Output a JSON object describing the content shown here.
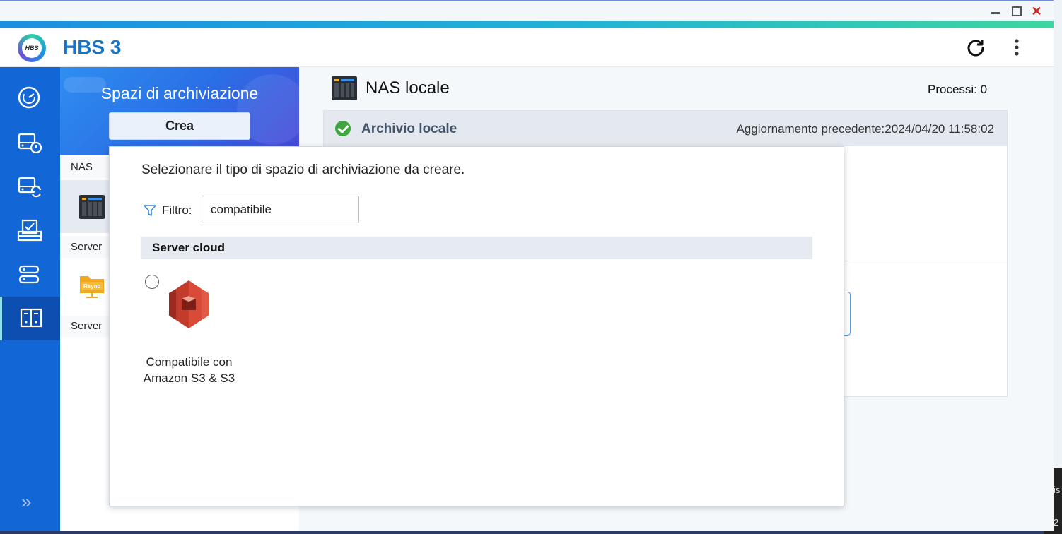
{
  "app": {
    "title": "HBS 3",
    "logo_text": "HBS"
  },
  "window_controls": {
    "minimize": "minimize-icon",
    "maximize": "maximize-icon",
    "close": "close-icon"
  },
  "header": {
    "refresh_icon": "refresh-icon",
    "more_icon": "more-vertical-icon"
  },
  "sidebar": {
    "items": [
      {
        "icon": "dashboard-gauge-icon"
      },
      {
        "icon": "backup-restore-icon"
      },
      {
        "icon": "sync-icon"
      },
      {
        "icon": "job-tasks-icon"
      },
      {
        "icon": "services-icon"
      },
      {
        "icon": "storage-spaces-icon",
        "active": true
      }
    ],
    "expand_icon": "double-chevron-right-icon"
  },
  "left_panel": {
    "title": "Spazi di archiviazione",
    "create_button": "Crea",
    "sections": [
      "NAS",
      "Server ",
      "Server "
    ]
  },
  "main": {
    "title": "NAS locale",
    "processes": "Processi: 0",
    "card": {
      "title": "Archivio locale",
      "last_update": "Aggiornamento precedente:2024/04/20 11:58:02"
    }
  },
  "modal": {
    "prompt": "Selezionare il tipo di spazio di archiviazione da creare.",
    "filter_label": "Filtro:",
    "filter_value": "compatibile",
    "section_title": "Server cloud",
    "option": {
      "label_line1": "Compatibile con",
      "label_line2": "Amazon S3 & S3"
    }
  },
  "desktop": {
    "edge_text_1": "is",
    "edge_text_2": "2"
  },
  "colors": {
    "accent": "#1773c7",
    "sidebar": "#1266d6",
    "success": "#3fa63f",
    "s3_red": "#d0402f"
  }
}
